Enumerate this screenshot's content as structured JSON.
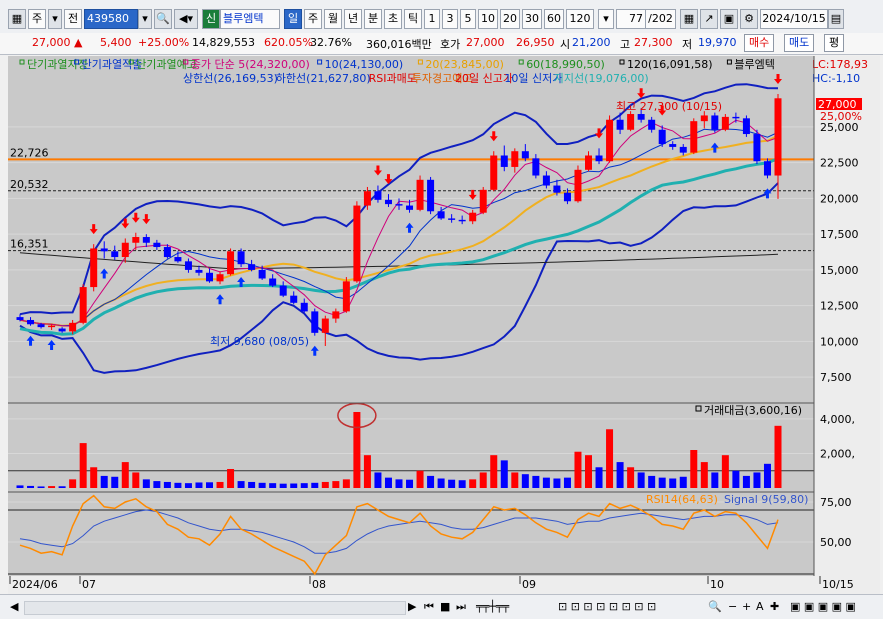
{
  "toolbar": {
    "market_label": "주",
    "type_label": "전",
    "code": "439580",
    "flag": "신",
    "name": "블루엠텍",
    "periods": [
      "일",
      "주",
      "월",
      "년",
      "분",
      "초",
      "틱"
    ],
    "active_period": "일",
    "intervals": [
      "1",
      "3",
      "5",
      "10",
      "20",
      "30",
      "60",
      "120"
    ],
    "count": "77",
    "count_total": "/202",
    "date": "2024/10/15"
  },
  "info": {
    "price": "27,000",
    "arrow": "▲",
    "change": "5,400",
    "change_pct": "+25.00%",
    "volume": "14,829,553",
    "volume_pct": "620.05%",
    "turnover_pct": "32.76%",
    "amount": "360,016백만",
    "quote_label": "호가",
    "ask": "27,000",
    "bid": "26,950",
    "open_label": "시",
    "open": "21,200",
    "high_label": "고",
    "high": "27,300",
    "low_label": "저",
    "low": "19,970",
    "buy_label": "매수",
    "sell_label": "매도",
    "eval_label": "평"
  },
  "legend": {
    "row1": [
      {
        "text": "단기과열지정",
        "color": "#1e8f1e"
      },
      {
        "text": "단기과열적출",
        "color": "#0033cc"
      },
      {
        "text": "단기과열예고",
        "color": "#1e8f1e"
      },
      {
        "text": "종가 단순 5(24,320,00)",
        "color": "#d0007a"
      },
      {
        "text": "10(24,130,00)",
        "color": "#0033cc"
      },
      {
        "text": "20(23,845,00)",
        "color": "#e8a000"
      },
      {
        "text": "60(18,990,50)",
        "color": "#1e8f1e"
      },
      {
        "text": "120(16,091,58)",
        "color": "#000000"
      },
      {
        "text": "블루엠텍",
        "color": "#000000"
      }
    ],
    "row2": [
      {
        "text": "상한선(26,169,53)",
        "color": "#0033cc"
      },
      {
        "text": "하한선(21,627,80)",
        "color": "#0033cc"
      },
      {
        "text": "RSI과매도",
        "color": "#e00000"
      },
      {
        "text": "투자경고예고",
        "color": "#e06000"
      },
      {
        "text": "20일 신고가",
        "color": "#e00000"
      },
      {
        "text": "10일 신저가",
        "color": "#0033cc"
      },
      {
        "text": "지지선(19,076,00)",
        "color": "#20b0b0"
      }
    ],
    "lc": "LC:178,93",
    "hc": "HC:-1,10"
  },
  "annotations": {
    "high": "최고 27,300 (10/15)",
    "low": "최저 9,680 (08/05)",
    "level1": "22,726",
    "level2": "20,532",
    "level3": "16,351",
    "price_tag": "27,000",
    "pct_tag": "25,00%"
  },
  "volume_panel": {
    "title": "거래대금(3,600,16)"
  },
  "rsi_panel": {
    "title": "RSI14(64,63)",
    "signal": "Signal 9(59,80)"
  },
  "colors": {
    "up": "#ff0000",
    "down": "#0000ff",
    "ma5": "#d0007a",
    "ma10": "#0033cc",
    "ma20": "#f0b020",
    "ma60": "#20b0b0",
    "ma120": "#222222",
    "bollinger": "#1020c0",
    "level": "#ff7a00",
    "rsi": "#ff8a00",
    "signal": "#3355cc"
  },
  "chart_data": {
    "type": "candlestick",
    "price_axis": {
      "ticks": [
        7500,
        10000,
        12500,
        15000,
        17500,
        20000,
        22500,
        25000
      ]
    },
    "volume_axis": {
      "ticks": [
        2000,
        4000
      ]
    },
    "rsi_axis": {
      "ticks": [
        50,
        75
      ]
    },
    "x_labels": [
      "2024/06",
      "07",
      "08",
      "09",
      "10",
      "10/15"
    ],
    "candles": [
      [
        11700,
        11900,
        11400,
        11500
      ],
      [
        11500,
        11700,
        11100,
        11200
      ],
      [
        11200,
        11300,
        10900,
        11000
      ],
      [
        11000,
        11200,
        10800,
        11100
      ],
      [
        10900,
        11000,
        10600,
        10700
      ],
      [
        10700,
        11500,
        10500,
        11300
      ],
      [
        11300,
        14000,
        11200,
        13800
      ],
      [
        13800,
        16800,
        13500,
        16500
      ],
      [
        16500,
        17000,
        15800,
        16300
      ],
      [
        16300,
        16700,
        15700,
        15900
      ],
      [
        15900,
        17200,
        15500,
        16900
      ],
      [
        16900,
        17600,
        16400,
        17300
      ],
      [
        17300,
        17500,
        16600,
        16900
      ],
      [
        16900,
        17100,
        16400,
        16600
      ],
      [
        16600,
        16800,
        15800,
        15900
      ],
      [
        15900,
        16300,
        15500,
        15600
      ],
      [
        15600,
        15800,
        14800,
        15000
      ],
      [
        15000,
        15300,
        14600,
        14800
      ],
      [
        14800,
        15100,
        14100,
        14200
      ],
      [
        14200,
        14900,
        14000,
        14700
      ],
      [
        14700,
        16500,
        14600,
        16300
      ],
      [
        16300,
        16500,
        15200,
        15400
      ],
      [
        15400,
        15700,
        14900,
        15000
      ],
      [
        15000,
        15300,
        14300,
        14400
      ],
      [
        14400,
        14700,
        13800,
        13900
      ],
      [
        13900,
        14200,
        13100,
        13200
      ],
      [
        13200,
        13500,
        12600,
        12700
      ],
      [
        12700,
        13000,
        12000,
        12100
      ],
      [
        12100,
        12300,
        10400,
        10600
      ],
      [
        10600,
        11800,
        9680,
        11600
      ],
      [
        11600,
        12300,
        11300,
        12100
      ],
      [
        12100,
        14500,
        12000,
        14200
      ],
      [
        14200,
        19800,
        14100,
        19500
      ],
      [
        19500,
        20800,
        19200,
        20500
      ],
      [
        20500,
        20900,
        19700,
        19900
      ],
      [
        19900,
        20300,
        19400,
        19600
      ],
      [
        19600,
        20000,
        19200,
        19500
      ],
      [
        19500,
        19900,
        19000,
        19200
      ],
      [
        19200,
        21600,
        19100,
        21300
      ],
      [
        21300,
        21500,
        18900,
        19100
      ],
      [
        19100,
        19400,
        18500,
        18600
      ],
      [
        18600,
        18900,
        18300,
        18500
      ],
      [
        18500,
        18800,
        18200,
        18400
      ],
      [
        18400,
        19200,
        18200,
        19000
      ],
      [
        19000,
        20800,
        18900,
        20600
      ],
      [
        20600,
        23300,
        20500,
        23000
      ],
      [
        23000,
        23700,
        21900,
        22200
      ],
      [
        22200,
        23500,
        21800,
        23300
      ],
      [
        23300,
        23800,
        22600,
        22800
      ],
      [
        22800,
        23100,
        21400,
        21600
      ],
      [
        21600,
        21900,
        20700,
        20900
      ],
      [
        20900,
        21300,
        20200,
        20400
      ],
      [
        20400,
        20700,
        19600,
        19800
      ],
      [
        19800,
        22300,
        19700,
        22000
      ],
      [
        22000,
        23300,
        21900,
        23000
      ],
      [
        23000,
        23500,
        22400,
        22600
      ],
      [
        22600,
        25800,
        22500,
        25500
      ],
      [
        25500,
        26000,
        24500,
        24800
      ],
      [
        24800,
        26100,
        24700,
        25900
      ],
      [
        25900,
        26300,
        25300,
        25500
      ],
      [
        25500,
        25700,
        24600,
        24800
      ],
      [
        24800,
        25100,
        23600,
        23800
      ],
      [
        23800,
        24000,
        23400,
        23600
      ],
      [
        23600,
        23800,
        23000,
        23200
      ],
      [
        23200,
        25600,
        23100,
        25400
      ],
      [
        25400,
        26100,
        24900,
        25800
      ],
      [
        25800,
        26000,
        24600,
        24800
      ],
      [
        24800,
        25900,
        24700,
        25700
      ],
      [
        25700,
        26000,
        25300,
        25600
      ],
      [
        25600,
        25800,
        24300,
        24500
      ],
      [
        24500,
        24800,
        22400,
        22600
      ],
      [
        22600,
        22800,
        21400,
        21600
      ],
      [
        21600,
        27300,
        19970,
        27000
      ]
    ],
    "volume": [
      150,
      120,
      90,
      110,
      100,
      500,
      2600,
      1200,
      700,
      650,
      1500,
      900,
      500,
      400,
      350,
      300,
      280,
      320,
      330,
      350,
      1100,
      400,
      350,
      300,
      280,
      250,
      260,
      280,
      300,
      350,
      400,
      500,
      4400,
      1900,
      900,
      600,
      500,
      480,
      1000,
      700,
      550,
      480,
      450,
      500,
      900,
      1900,
      1600,
      900,
      800,
      700,
      600,
      550,
      600,
      2100,
      1900,
      1200,
      3400,
      1500,
      1200,
      900,
      700,
      600,
      550,
      650,
      2200,
      1500,
      900,
      1900,
      1000,
      700,
      900,
      1400,
      3600
    ],
    "rsi": [
      48,
      46,
      43,
      44,
      42,
      60,
      74,
      79,
      72,
      71,
      75,
      77,
      72,
      69,
      61,
      58,
      53,
      52,
      48,
      55,
      66,
      58,
      55,
      51,
      47,
      44,
      41,
      38,
      30,
      42,
      48,
      54,
      72,
      74,
      70,
      66,
      64,
      62,
      68,
      60,
      55,
      53,
      52,
      56,
      64,
      72,
      70,
      71,
      67,
      62,
      58,
      56,
      53,
      64,
      68,
      66,
      74,
      71,
      73,
      70,
      66,
      61,
      60,
      58,
      68,
      70,
      66,
      69,
      68,
      62,
      54,
      46,
      64
    ],
    "signal": [
      52,
      51,
      49,
      48,
      47,
      49,
      54,
      60,
      63,
      65,
      67,
      69,
      70,
      69,
      67,
      65,
      62,
      60,
      58,
      57,
      58,
      58,
      57,
      56,
      54,
      52,
      50,
      47,
      43,
      43,
      44,
      46,
      51,
      55,
      58,
      60,
      61,
      62,
      63,
      62,
      61,
      59,
      58,
      58,
      59,
      61,
      63,
      65,
      65,
      65,
      64,
      63,
      61,
      62,
      63,
      63,
      65,
      66,
      67,
      68,
      67,
      66,
      65,
      64,
      65,
      66,
      66,
      67,
      67,
      66,
      64,
      61,
      62
    ]
  }
}
